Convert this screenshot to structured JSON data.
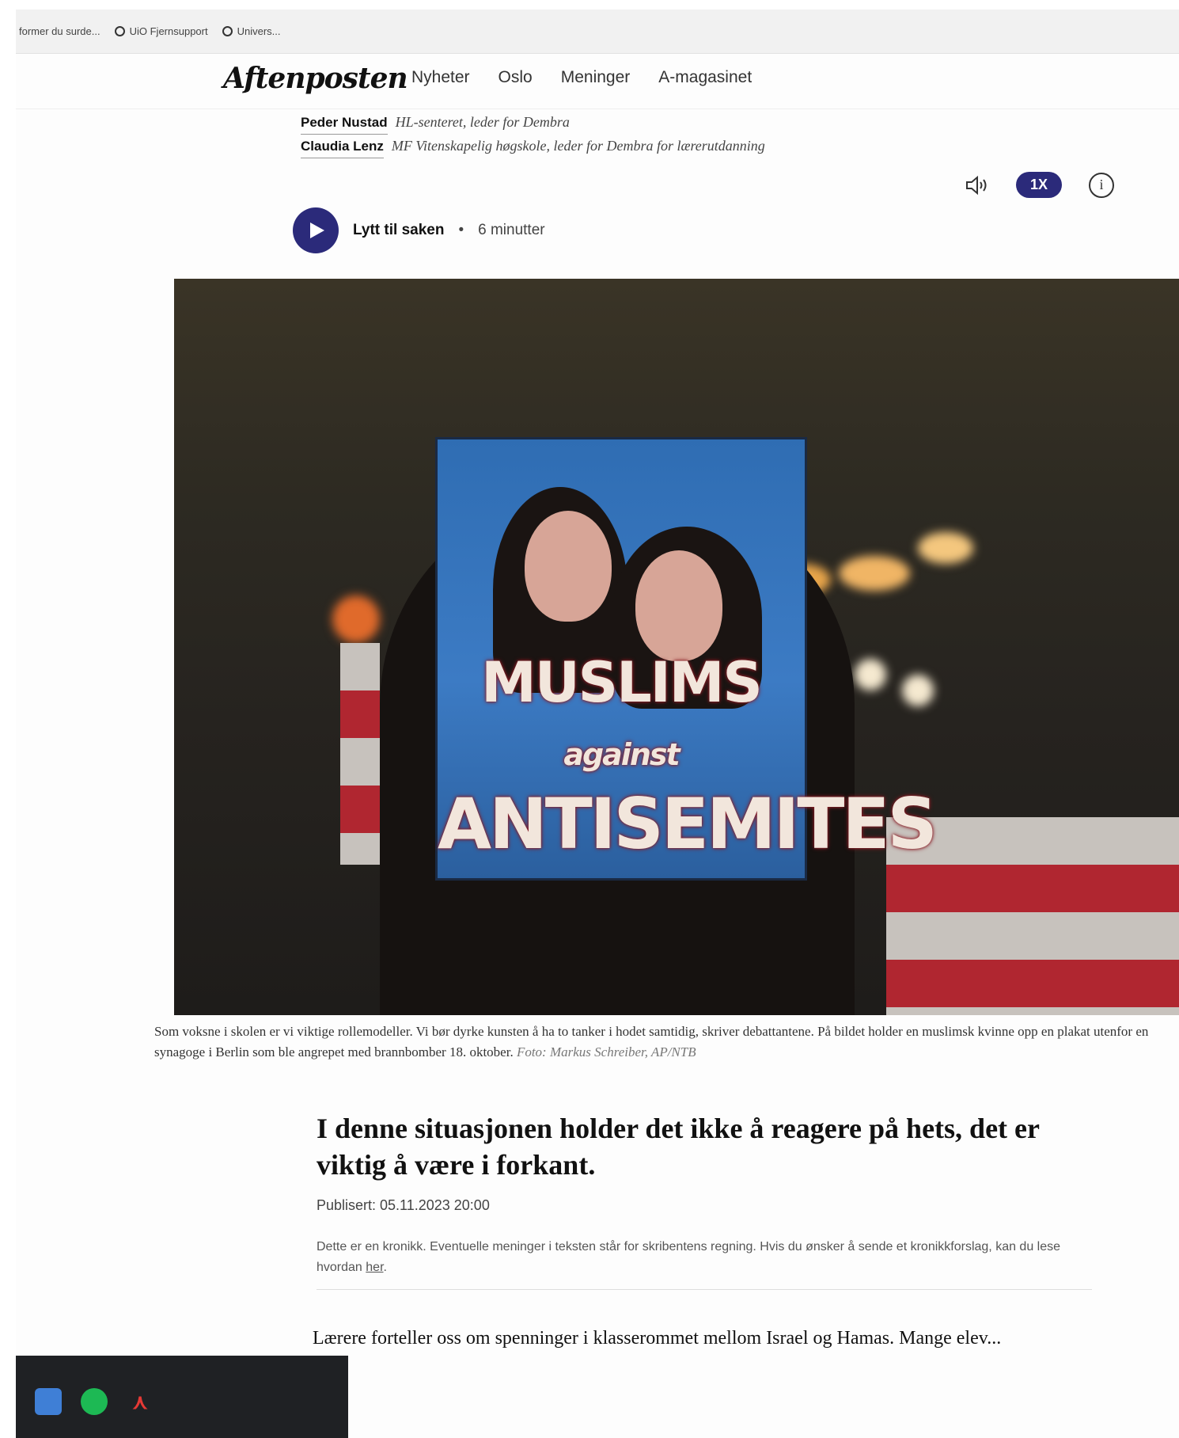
{
  "bookmarks": [
    {
      "label": "former du surde..."
    },
    {
      "label": "UiO Fjernsupport"
    },
    {
      "label": "Univers..."
    }
  ],
  "site": {
    "logo": "Aftenposten",
    "nav": [
      "Nyheter",
      "Oslo",
      "Meninger",
      "A-magasinet"
    ]
  },
  "authors": [
    {
      "name": "Peder Nustad",
      "role": "HL-senteret, leder for Dembra"
    },
    {
      "name": "Claudia Lenz",
      "role": "MF Vitenskapelig høgskole, leder for Dembra for lærerutdanning"
    }
  ],
  "audio": {
    "label": "Lytt til saken",
    "separator": "•",
    "duration": "6 minutter",
    "speed": "1X",
    "info": "i"
  },
  "image": {
    "placard_line1": "MUSLIMS",
    "placard_line1_small": "against",
    "placard_line2": "ANTISEMITES"
  },
  "caption": {
    "text": "Som voksne i skolen er vi viktige rollemodeller. Vi bør dyrke kunsten å ha to tanker i hodet samtidig, skriver debattantene. På bildet holder en muslimsk kvinne opp en plakat utenfor en synagoge i Berlin som ble angrepet med brannbomber 18. oktober.",
    "credit": "Foto: Markus Schreiber, AP/NTB"
  },
  "article": {
    "headline": "I denne situasjonen holder det ikke å reagere på hets, det er viktig å være i forkant.",
    "published": "Publisert: 05.11.2023 20:00",
    "disclaimer": "Dette er en kronikk. Eventuelle meninger i teksten står for skribentens regning. Hvis du ønsker å sende et kronikkforslag, kan du lese hvordan",
    "disclaimer_link": "her",
    "disclaimer_end": ".",
    "body": "Lærere forteller oss om spenninger i klasserommet mellom Israel og Hamas. Mange elev..."
  },
  "colors": {
    "accent": "#2b2a7a",
    "placard_blue": "#2f6db3",
    "barrier_red": "#b02630"
  }
}
